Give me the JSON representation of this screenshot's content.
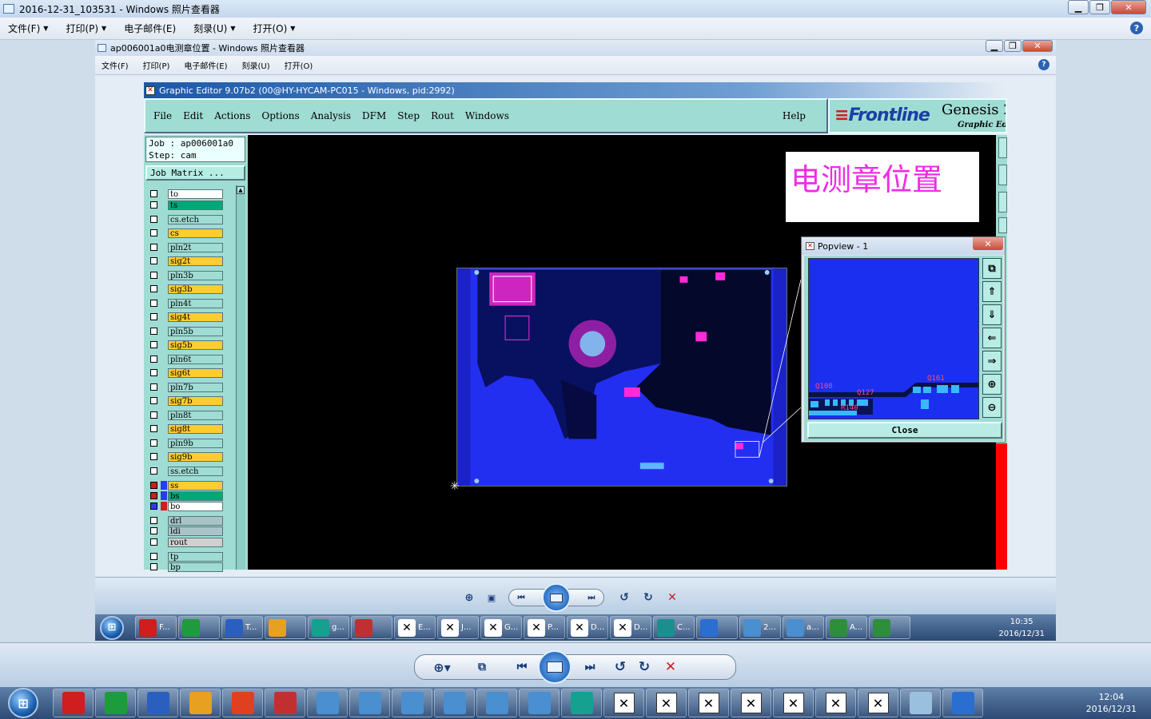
{
  "outer_window": {
    "title": "2016-12-31_103531 - Windows 照片查看器",
    "menu": [
      "文件(F)",
      "打印(P)",
      "电子邮件(E)",
      "刻录(U)",
      "打开(O)"
    ],
    "help_glyph": "?"
  },
  "inner_window": {
    "title": "ap006001a0电测章位置 - Windows 照片查看器",
    "menu": [
      "文件(F)",
      "打印(P)",
      "电子邮件(E)",
      "刻录(U)",
      "打开(O)"
    ]
  },
  "genesis": {
    "title": "Graphic Editor 9.07b2 (00@HY-HYCAM-PC015 - Windows, pid:2992)",
    "menu": [
      "File",
      "Edit",
      "Actions",
      "Options",
      "Analysis",
      "DFM",
      "Step",
      "Rout",
      "Windows"
    ],
    "help": "Help",
    "logo_brand": "Frontline",
    "logo_product": "Genesis 2",
    "logo_sub": "Graphic Edi",
    "job_line": "Job : ap006001a0",
    "step_line": "Step: cam",
    "job_matrix": "Job Matrix ...",
    "layers": [
      {
        "name": "to",
        "color": "#ffffff"
      },
      {
        "name": "ts",
        "color": "#00a878"
      },
      {
        "name": "cs.etch",
        "color": "#9fdcd3"
      },
      {
        "name": "cs",
        "color": "#ffcc33"
      },
      {
        "name": "pln2t",
        "color": "#9fdcd3"
      },
      {
        "name": "sig2t",
        "color": "#ffcc33"
      },
      {
        "name": "pln3b",
        "color": "#9fdcd3"
      },
      {
        "name": "sig3b",
        "color": "#ffcc33"
      },
      {
        "name": "pln4t",
        "color": "#9fdcd3"
      },
      {
        "name": "sig4t",
        "color": "#ffcc33"
      },
      {
        "name": "pln5b",
        "color": "#9fdcd3"
      },
      {
        "name": "sig5b",
        "color": "#ffcc33"
      },
      {
        "name": "pln6t",
        "color": "#9fdcd3"
      },
      {
        "name": "sig6t",
        "color": "#ffcc33"
      },
      {
        "name": "pln7b",
        "color": "#9fdcd3"
      },
      {
        "name": "sig7b",
        "color": "#ffcc33"
      },
      {
        "name": "pln8t",
        "color": "#9fdcd3"
      },
      {
        "name": "sig8t",
        "color": "#ffcc33"
      },
      {
        "name": "pln9b",
        "color": "#9fdcd3"
      },
      {
        "name": "sig9b",
        "color": "#ffcc33"
      },
      {
        "name": "ss.etch",
        "color": "#9fdcd3"
      },
      {
        "name": "ss",
        "color": "#ffcc33"
      },
      {
        "name": "bs",
        "color": "#00a878"
      },
      {
        "name": "bo",
        "color": "#ffffff"
      },
      {
        "name": "drl",
        "color": "#a9c4c8"
      },
      {
        "name": "ldi",
        "color": "#a9c4c8"
      },
      {
        "name": "rout",
        "color": "#d0d0d0"
      },
      {
        "name": "tp",
        "color": "#9fdcd3"
      },
      {
        "name": "bp",
        "color": "#9fdcd3"
      }
    ],
    "annotation": "电测章位置",
    "popview": {
      "title": "Popview - 1",
      "close": "Close",
      "labels": [
        "Q108",
        "Q127",
        "Q161",
        "R140"
      ]
    }
  },
  "taskbar_inner": {
    "items": [
      "F...",
      "",
      "T...",
      "",
      "g...",
      "",
      "E...",
      "J...",
      "G...",
      "P...",
      "D...",
      "D...",
      "C...",
      "",
      "2...",
      "a...",
      "A...",
      ""
    ],
    "time": "10:35",
    "date": "2016/12/31"
  },
  "taskbar_outer": {
    "time": "12:04",
    "date": "2016/12/31"
  },
  "colors": {
    "genesis_panel": "#9fdcd3",
    "pcb_blue": "#232ff0",
    "pcb_pink": "#ff2bd8",
    "annotation_text": "#f02be6"
  }
}
